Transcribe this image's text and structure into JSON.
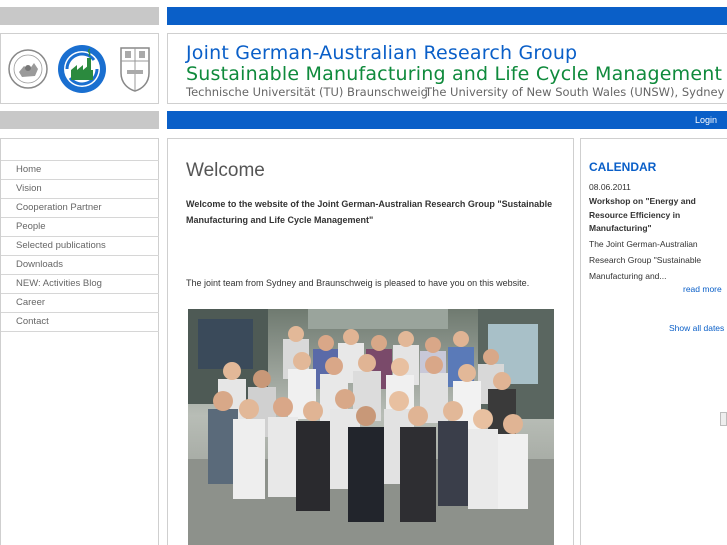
{
  "header": {
    "title_line1": "Joint German-Australian Research Group",
    "title_line2": "Sustainable Manufacturing and Life Cycle Management",
    "subtitle_left": "Technische Universität (TU) Braunschweig",
    "subtitle_right": "The University of New South Wales (UNSW), Sydney"
  },
  "login_label": "Login",
  "nav": {
    "items": [
      {
        "label": "Home"
      },
      {
        "label": "Vision"
      },
      {
        "label": "Cooperation Partner"
      },
      {
        "label": "People"
      },
      {
        "label": "Selected publications"
      },
      {
        "label": "Downloads"
      },
      {
        "label": "NEW: Activities Blog"
      },
      {
        "label": "Career"
      },
      {
        "label": "Contact"
      }
    ]
  },
  "main": {
    "heading": "Welcome",
    "intro": "Welcome to the website of the Joint German-Australian Research Group \"Sustainable Manufacturing and Life Cycle Management\"",
    "greeting": "The joint team from Sydney and Braunschweig is pleased to have you on this website."
  },
  "calendar": {
    "heading": "CALENDAR",
    "date": "08.06.2011",
    "event_title": "Workshop on \"Energy and Resource Efficiency in Manufacturing\"",
    "event_text": "The Joint German-Australian Research Group \"Sustainable Manufacturing and...",
    "read_more": "read more",
    "show_all": "Show all dates"
  },
  "colors": {
    "brand_blue": "#0a5fc8",
    "brand_green": "#0f8a3c",
    "bar_gray": "#c8c8c8"
  },
  "logos": [
    "tu-braunschweig-seal-icon",
    "recycling-factory-icon",
    "unsw-crest-icon"
  ]
}
